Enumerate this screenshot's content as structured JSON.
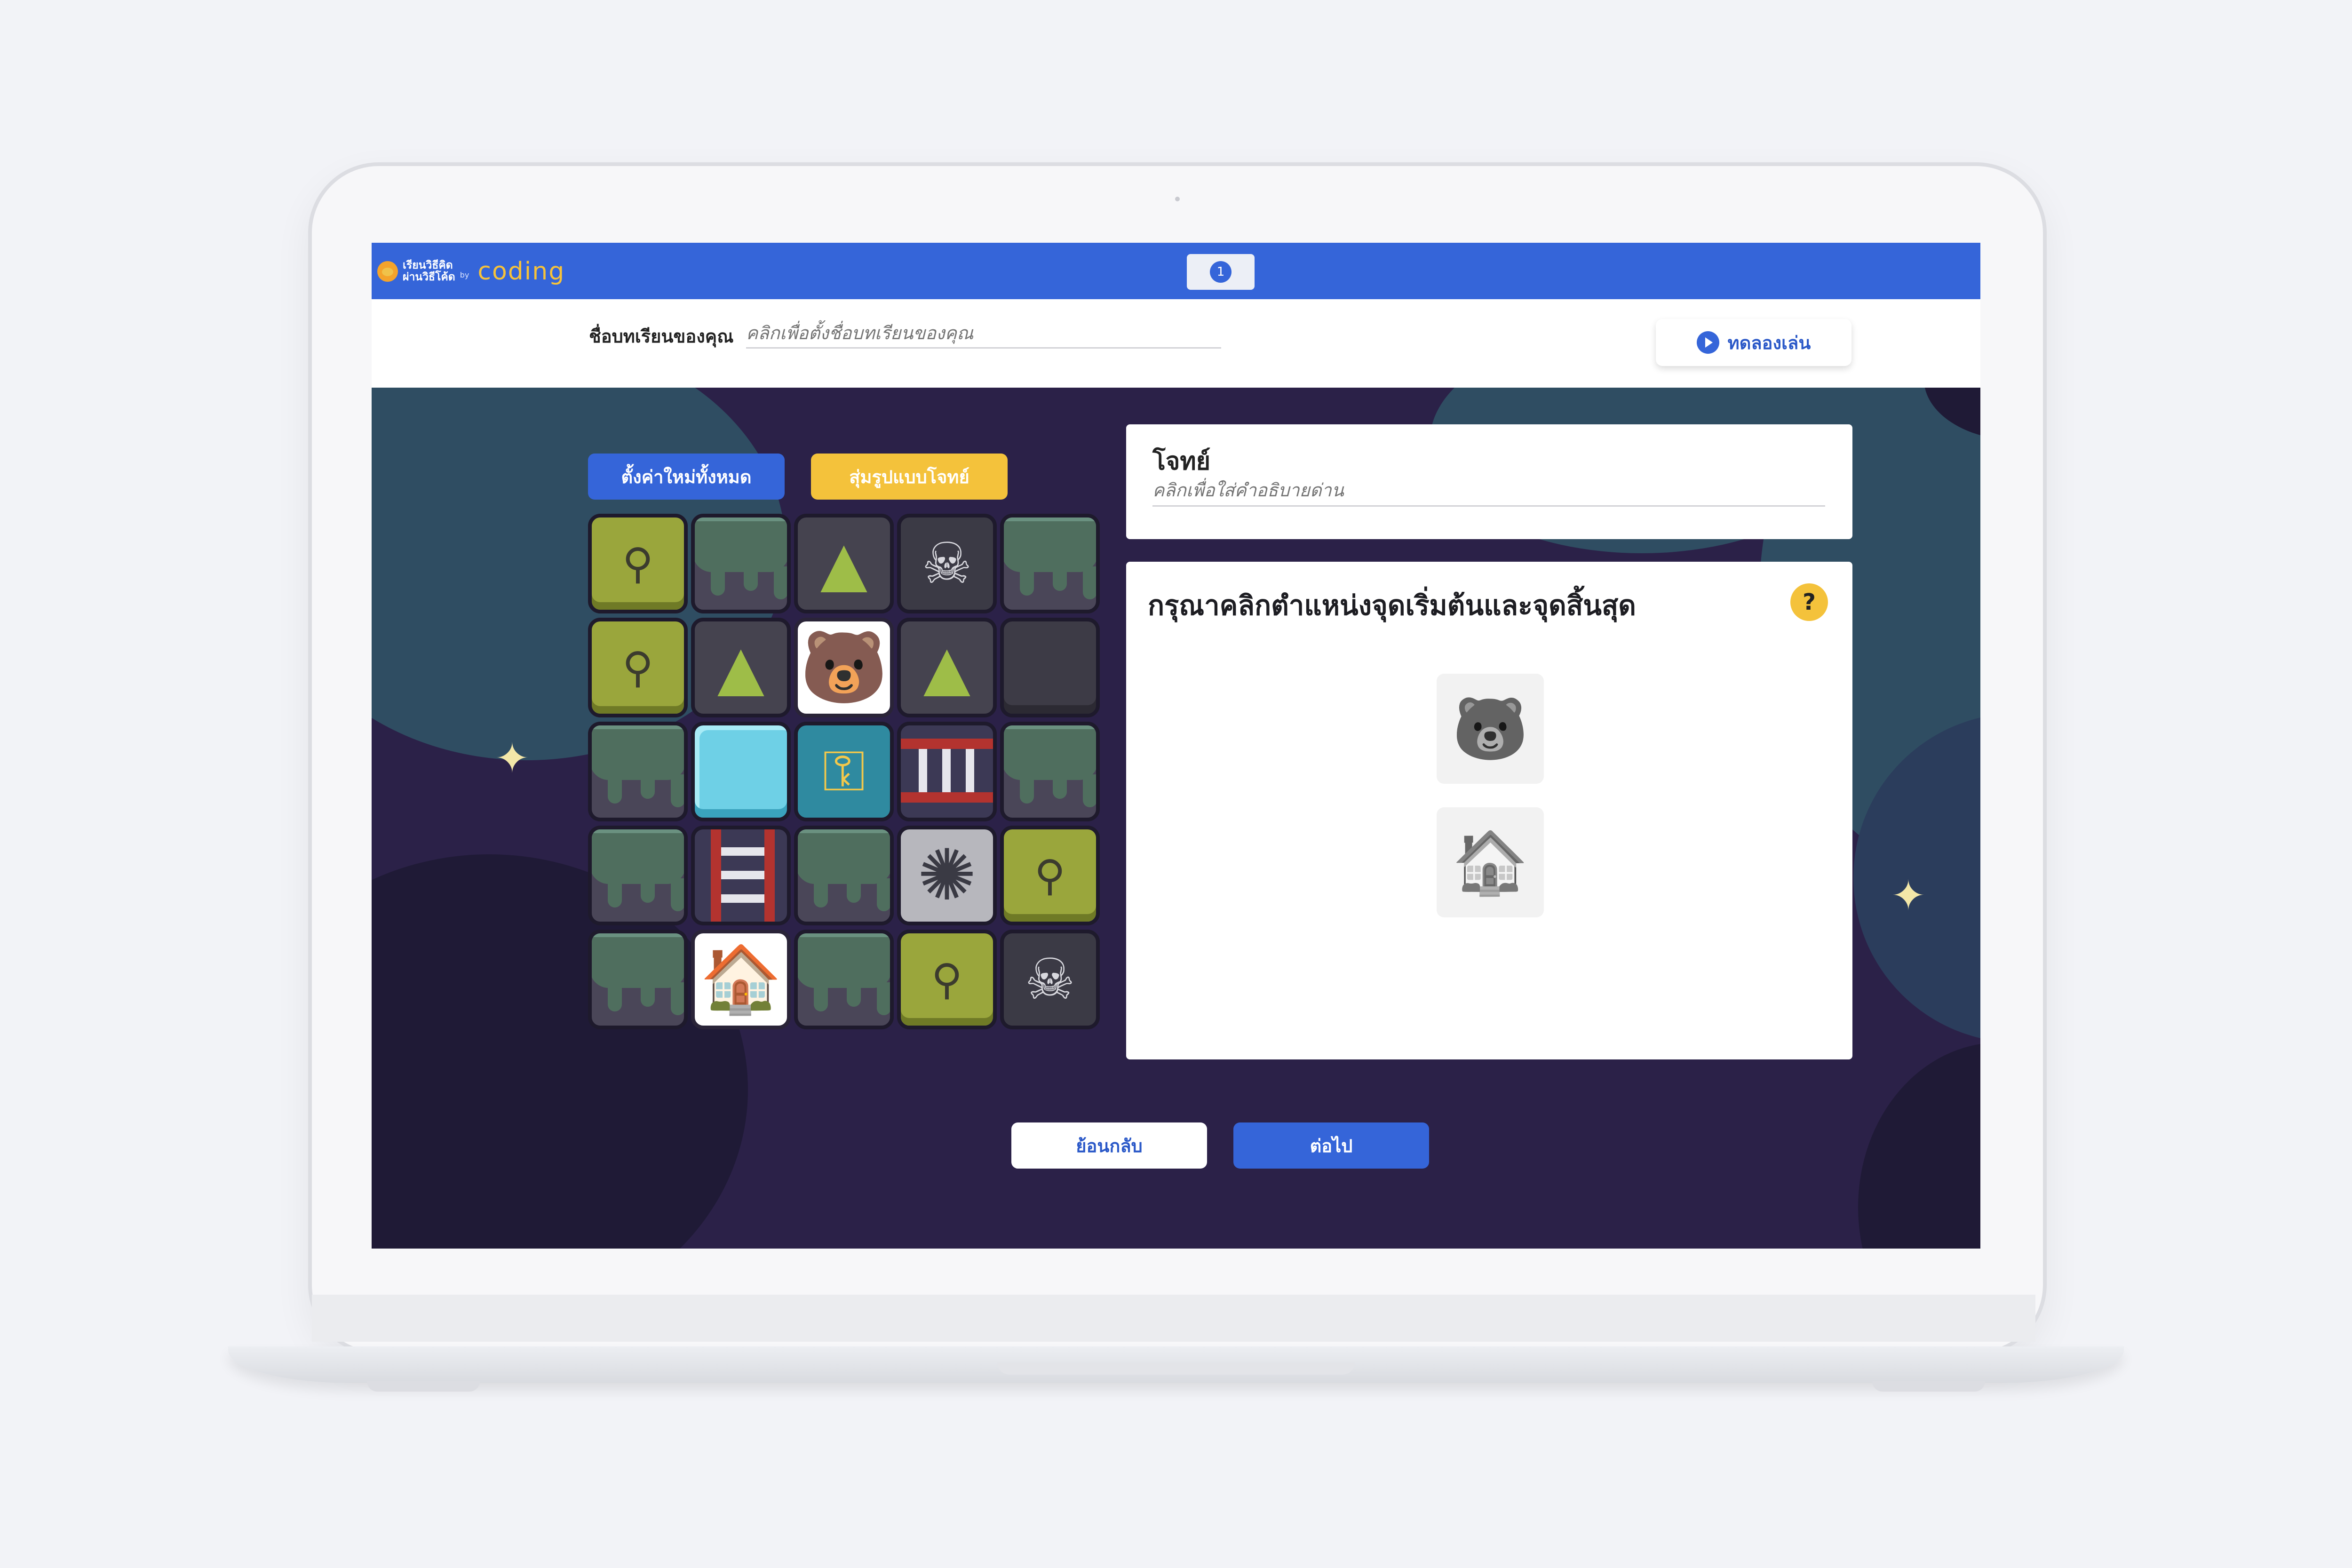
{
  "header": {
    "logo_line1": "เรียนวิธีคิด",
    "logo_line2": "ผ่านวิธีโค้ด",
    "logo_by": "by",
    "logo_brand": "coding",
    "step_number": "1"
  },
  "lesson": {
    "label": "ชื่อบทเรียนของคุณ",
    "placeholder": "คลิกเพื่อตั้งชื่อบทเรียนของคุณ",
    "trial_button": "ทดลองเล่น"
  },
  "board": {
    "reset_button": "ตั้งค่าใหม่ทั้งหมด",
    "random_button": "สุ่มรูปแบบโจทย์",
    "tiles": [
      [
        "grass-bone",
        "slime",
        "tree",
        "skull",
        "slime"
      ],
      [
        "grass-bone",
        "tree",
        "bear",
        "tree",
        "dark-rock"
      ],
      [
        "slime",
        "ice-block",
        "key",
        "ladder-horizontal",
        "slime"
      ],
      [
        "slime",
        "ladder-vertical",
        "slime",
        "spider-web",
        "grass-bone"
      ],
      [
        "slime",
        "candy-house",
        "slime",
        "grass-bone",
        "skull"
      ]
    ]
  },
  "problem": {
    "title": "โจทย์",
    "placeholder": "คลิกเพื่อใส่คำอธิบายด่าน"
  },
  "task": {
    "instruction": "กรุณาคลิกตำแหน่งจุดเริ่มต้นและจุดสิ้นสุด",
    "help": "?",
    "start_icon": "bear-icon",
    "end_icon": "candy-house-icon"
  },
  "footer": {
    "back_button": "ย้อนกลับ",
    "next_button": "ต่อไป"
  },
  "colors": {
    "primary": "#3565d9",
    "accent": "#f4c23b",
    "background": "#2b2148"
  }
}
